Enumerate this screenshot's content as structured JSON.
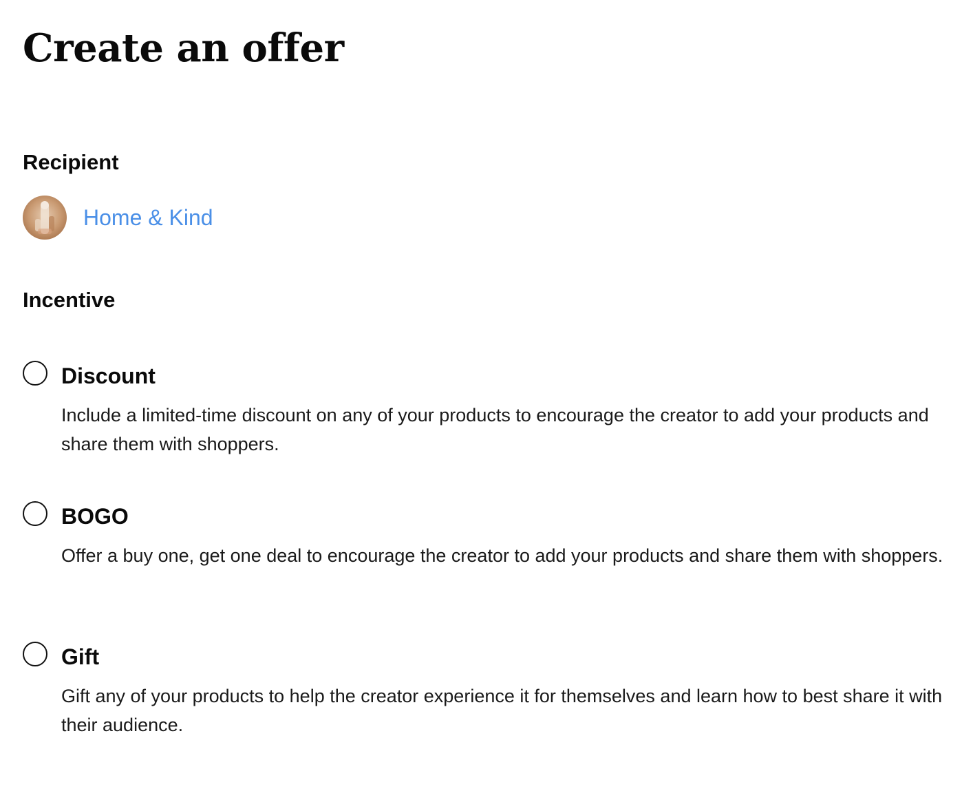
{
  "page": {
    "title": "Create an offer"
  },
  "recipient": {
    "heading": "Recipient",
    "name": "Home & Kind"
  },
  "incentive": {
    "heading": "Incentive",
    "options": [
      {
        "label": "Discount",
        "description": "Include a limited-time discount on any of your products to encourage the creator to add your products and share them with shoppers.",
        "selected": false
      },
      {
        "label": "BOGO",
        "description": "Offer a buy one, get one deal to encourage the creator to add your products and share them with shoppers.",
        "selected": false
      },
      {
        "label": "Gift",
        "description": "Gift any of your products to help the creator experience it for themselves and learn how to best share it with their audience.",
        "selected": false
      }
    ]
  },
  "colors": {
    "link": "#4a8fe7",
    "text": "#0a0a0a",
    "radio_border": "#111111"
  }
}
